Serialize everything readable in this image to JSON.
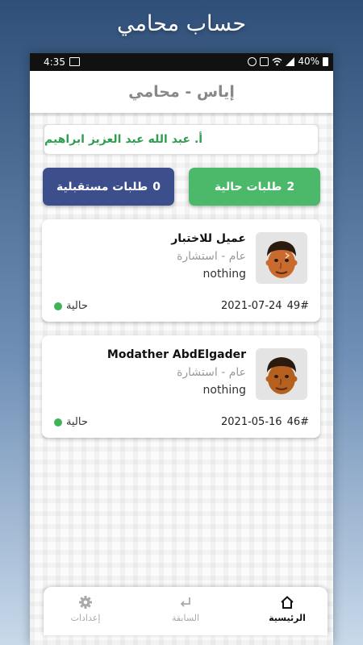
{
  "promo_title": "حساب محامي",
  "status_bar": {
    "time": "4:35",
    "battery": "40%"
  },
  "header": {
    "title": "إياس - محامي"
  },
  "lawyer": {
    "name": "أ. عبد الله عبد العزيز ابراهيم"
  },
  "buttons": {
    "current_count": "2",
    "current_label": "طلبات حالية",
    "future_count": "0",
    "future_label": "طلبات مستقبلية"
  },
  "requests": [
    {
      "client": "عميل للاختبار",
      "category": "عام - استشارة",
      "note": "nothing",
      "number": "49#",
      "date": "2021-07-24",
      "status": "حالية"
    },
    {
      "client": "Modather AbdElgader",
      "category": "عام - استشارة",
      "note": "nothing",
      "number": "46#",
      "date": "2021-05-16",
      "status": "حالية"
    }
  ],
  "nav": {
    "home": "الرئيسية",
    "previous": "السابقة",
    "settings": "إعدادات"
  },
  "colors": {
    "green": "#4cb96a",
    "navy": "#3c4f8c",
    "lawyer_text": "#2e9e4f",
    "status_dot": "#3db555"
  },
  "icons": {
    "home": "home-icon",
    "previous": "return-arrow-icon",
    "settings": "gear-icon",
    "avatar": "avatar-icon"
  }
}
